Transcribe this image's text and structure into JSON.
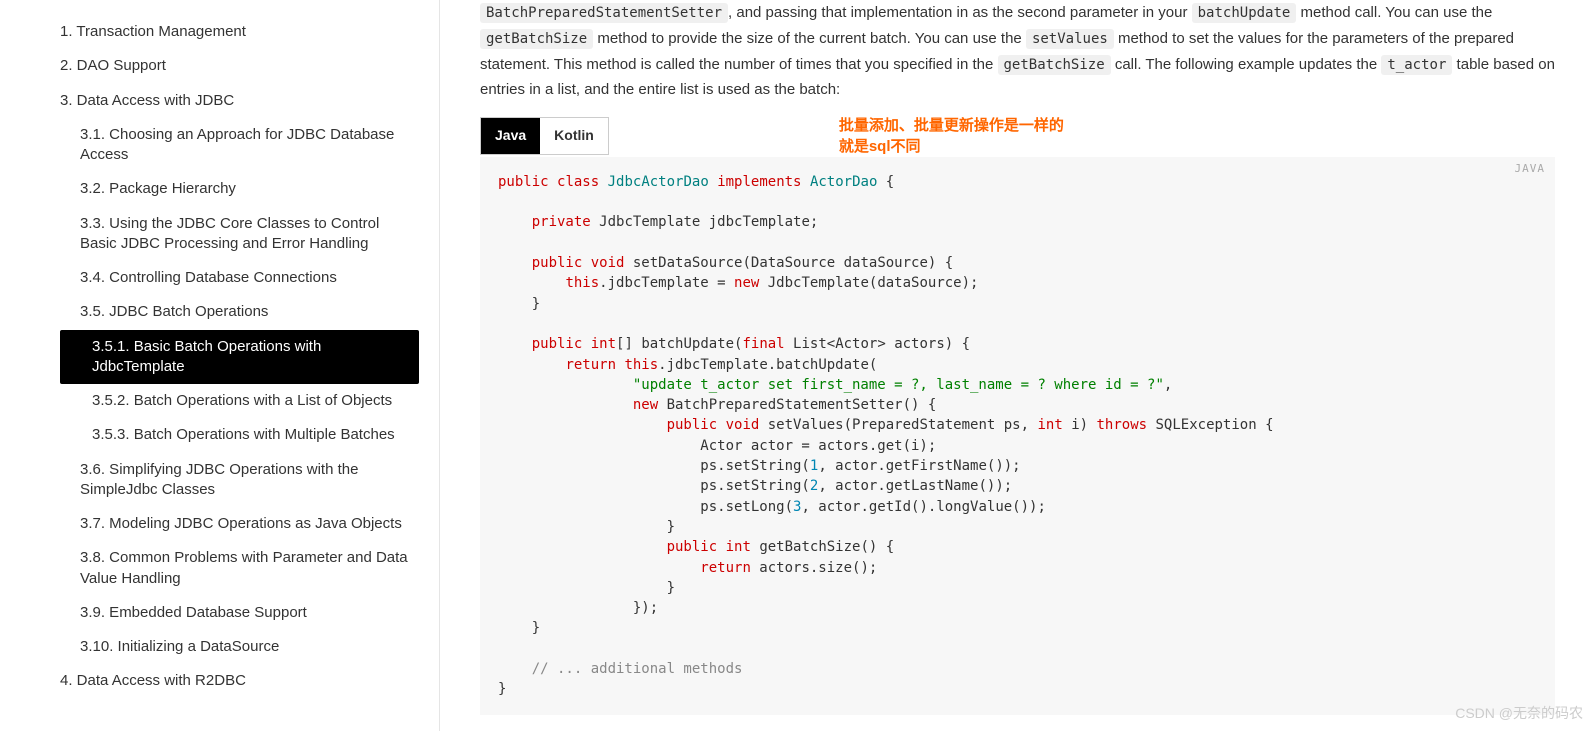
{
  "sidebar": {
    "items": [
      {
        "label": "1. Transaction Management",
        "level": 1
      },
      {
        "label": "2. DAO Support",
        "level": 1
      },
      {
        "label": "3. Data Access with JDBC",
        "level": 1
      },
      {
        "label": "3.1. Choosing an Approach for JDBC Database Access",
        "level": 2
      },
      {
        "label": "3.2. Package Hierarchy",
        "level": 2
      },
      {
        "label": "3.3. Using the JDBC Core Classes to Control Basic JDBC Processing and Error Handling",
        "level": 2
      },
      {
        "label": "3.4. Controlling Database Connections",
        "level": 2
      },
      {
        "label": "3.5. JDBC Batch Operations",
        "level": 2
      },
      {
        "label": "3.5.1. Basic Batch Operations with JdbcTemplate",
        "level": 3,
        "active": true
      },
      {
        "label": "3.5.2. Batch Operations with a List of Objects",
        "level": 3
      },
      {
        "label": "3.5.3. Batch Operations with Multiple Batches",
        "level": 3
      },
      {
        "label": "3.6. Simplifying JDBC Operations with the SimpleJdbc Classes",
        "level": 2
      },
      {
        "label": "3.7. Modeling JDBC Operations as Java Objects",
        "level": 2
      },
      {
        "label": "3.8. Common Problems with Parameter and Data Value Handling",
        "level": 2
      },
      {
        "label": "3.9. Embedded Database Support",
        "level": 2
      },
      {
        "label": "3.10. Initializing a DataSource",
        "level": 2
      },
      {
        "label": "4. Data Access with R2DBC",
        "level": 1
      }
    ]
  },
  "content": {
    "p1_parts": [
      "BatchPreparedStatementSetter",
      ", and passing that implementation in as the second parameter in your ",
      "batchUpdate",
      " method call. You can use the ",
      "getBatchSize",
      " method to provide the size of the current batch. You can use the ",
      "setValues",
      " method to set the values for the parameters of the prepared statement. This method is called the number of times that you specified in the ",
      "getBatchSize",
      " call. The following example updates the ",
      "t_actor",
      " table based on entries in a list, and the entire list is used as the batch:"
    ],
    "tabs": {
      "java": "Java",
      "kotlin": "Kotlin"
    },
    "annotation": {
      "line1": "批量添加、批量更新操作是一样的",
      "line2": "就是sql不同"
    },
    "code_lang": "JAVA",
    "code": {
      "l1_a": "public",
      "l1_b": "class",
      "l1_c": "JdbcActorDao",
      "l1_d": "implements",
      "l1_e": "ActorDao",
      "l1_f": " {",
      "l2_a": "private",
      "l2_b": "JdbcTemplate",
      "l2_c": " jdbcTemplate;",
      "l3_a": "public",
      "l3_b": "void",
      "l3_c": " setDataSource(DataSource dataSource) {",
      "l4_a": "this",
      "l4_b": ".jdbcTemplate = ",
      "l4_c": "new",
      "l4_d": " JdbcTemplate(dataSource);",
      "l5": "    }",
      "l6_a": "public",
      "l6_b": "int",
      "l6_c": "[] batchUpdate(",
      "l6_d": "final",
      "l6_e": " List<Actor> actors) {",
      "l7_a": "return",
      "l7_b": "this",
      "l7_c": ".jdbcTemplate.batchUpdate(",
      "l8": "\"update t_actor set first_name = ?, last_name = ? where id = ?\"",
      "l8_suffix": ",",
      "l9_a": "new",
      "l9_b": " BatchPreparedStatementSetter() {",
      "l10_a": "public",
      "l10_b": "void",
      "l10_c": " setValues(PreparedStatement ps, ",
      "l10_d": "int",
      "l10_e": " i) ",
      "l10_f": "throws",
      "l10_g": " SQLException {",
      "l11": "                        Actor actor = actors.get(i);",
      "l12_a": "                        ps.setString(",
      "l12_b": "1",
      "l12_c": ", actor.getFirstName());",
      "l13_a": "                        ps.setString(",
      "l13_b": "2",
      "l13_c": ", actor.getLastName());",
      "l14_a": "                        ps.setLong(",
      "l14_b": "3",
      "l14_c": ", actor.getId().longValue());",
      "l15": "                    }",
      "l16_a": "public",
      "l16_b": "int",
      "l16_c": " getBatchSize() {",
      "l17_a": "return",
      "l17_b": " actors.size();",
      "l18": "                    }",
      "l19": "                });",
      "l20": "    }",
      "l21": "// ... additional methods",
      "l22": "}"
    }
  },
  "watermark": "CSDN @无奈的码农"
}
